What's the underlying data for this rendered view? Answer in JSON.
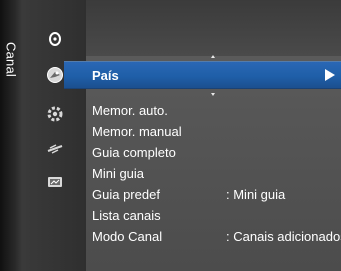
{
  "rail": {
    "label": "Canal"
  },
  "menu": {
    "selected": {
      "label": "País"
    },
    "items": [
      {
        "label": "Memor. auto.",
        "value": ""
      },
      {
        "label": "Memor. manual",
        "value": ""
      },
      {
        "label": "Guia completo",
        "value": ""
      },
      {
        "label": "Mini guia",
        "value": ""
      },
      {
        "label": "Guia predef",
        "value": ": Mini guia"
      },
      {
        "label": "Lista canais",
        "value": ""
      },
      {
        "label": "Modo Canal",
        "value": ": Canais adicionados"
      }
    ]
  },
  "icons": [
    "picture-icon",
    "channel-icon",
    "setup-icon",
    "input-icon",
    "application-icon"
  ],
  "colors": {
    "accent": "#2A67B5",
    "background_top": "#3B3B3B",
    "background_body": "#5A5A5A",
    "text": "#FFFFFF"
  }
}
